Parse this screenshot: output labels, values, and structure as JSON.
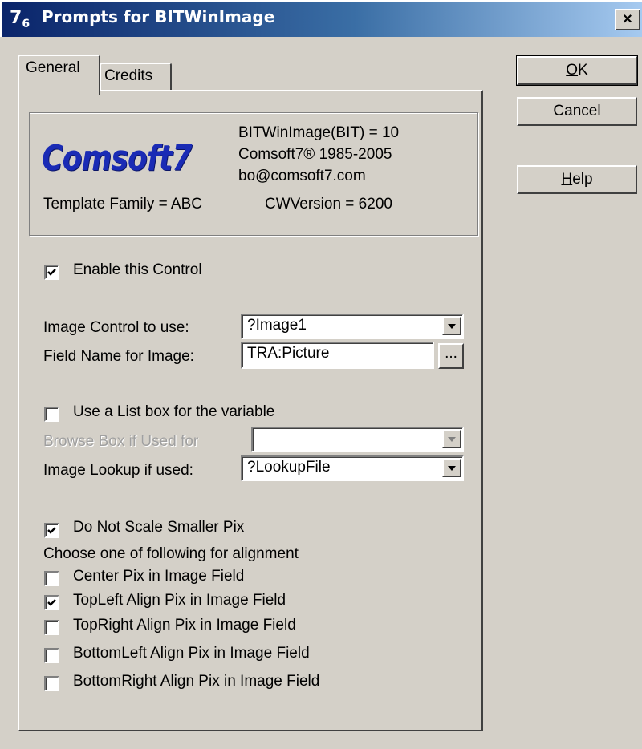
{
  "window": {
    "icon_main": "7",
    "icon_sub": "6",
    "title": "Prompts for BITWinImage",
    "close_glyph": "×"
  },
  "tabs": [
    {
      "label": "General",
      "selected": true
    },
    {
      "label": "Credits",
      "selected": false
    }
  ],
  "info": {
    "logo": "Comsoft7",
    "line1": "BITWinImage(BIT) = 10",
    "line2": "Comsoft7® 1985-2005",
    "line3": "bo@comsoft7.com",
    "template_family": "Template Family = ABC",
    "cw_version": "CWVersion = 6200"
  },
  "controls": {
    "enable_label": "Enable this Control",
    "enable_checked": true,
    "image_control_label": "Image Control to use:",
    "image_control_value": "?Image1",
    "field_name_label": "Field Name for Image:",
    "field_name_value": "TRA:Picture",
    "ellipsis": "...",
    "use_listbox_label": "Use a List box for the variable",
    "use_listbox_checked": false,
    "browse_box_label": "Browse Box if Used for",
    "browse_box_value": "",
    "image_lookup_label": "Image Lookup if used:",
    "image_lookup_value": "?LookupFile",
    "no_scale_label": "Do Not Scale Smaller Pix",
    "no_scale_checked": true,
    "choose_label": "Choose one of following for alignment",
    "align": [
      {
        "label": "Center Pix in Image Field",
        "checked": false
      },
      {
        "label": "TopLeft Align Pix in Image Field",
        "checked": true
      },
      {
        "label": "TopRight Align Pix in Image Field",
        "checked": false
      },
      {
        "label": "BottomLeft Align Pix in Image Field",
        "checked": false
      },
      {
        "label": "BottomRight Align Pix in Image Field",
        "checked": false
      }
    ]
  },
  "buttons": {
    "ok_prefix": "",
    "ok_u": "O",
    "ok_rest": "K",
    "cancel": "Cancel",
    "help_u": "H",
    "help_rest": "elp"
  }
}
